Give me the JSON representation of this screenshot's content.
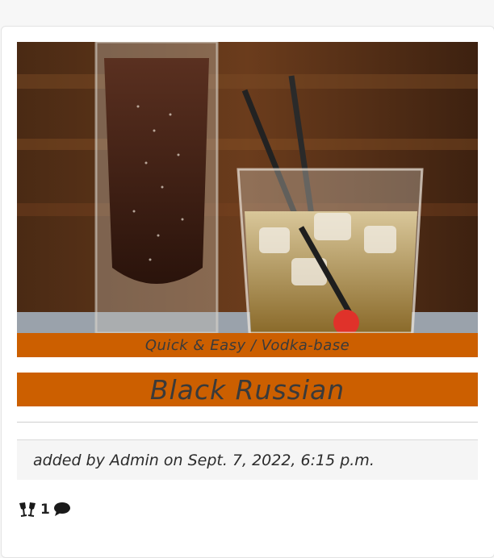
{
  "recipe": {
    "category_label": "Quick & Easy / Vodka-base",
    "title": "Black Russian",
    "meta": {
      "added_by_prefix": "added by",
      "author": "Admin",
      "on_word": "on",
      "date": "Sept. 7, 2022, 6:15 p.m."
    },
    "likes_count": "1"
  },
  "icons": {
    "likes": "glasses-cheers-icon",
    "comments": "comment-icon"
  },
  "colors": {
    "accent": "#cc5f00",
    "text": "#3a3a3a"
  }
}
